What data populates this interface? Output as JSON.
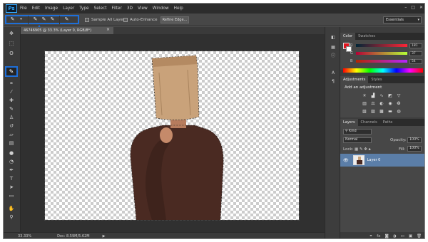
{
  "app": {
    "logo": "Ps"
  },
  "menu": [
    "File",
    "Edit",
    "Image",
    "Layer",
    "Type",
    "Select",
    "Filter",
    "3D",
    "View",
    "Window",
    "Help"
  ],
  "window_controls": [
    "–",
    "□",
    "✕"
  ],
  "options_bar": {
    "sample_all_layers": "Sample All Layers",
    "auto_enhance": "Auto-Enhance",
    "refine_edge": "Refine Edge...",
    "workspace": "Essentials"
  },
  "document": {
    "tab_title": "46746905 @ 33.3% (Layer 0, RGB/8*)",
    "tab_close": "×"
  },
  "status": {
    "zoom": "33.33%",
    "doc_info": "Doc: 8.59M/5.62M"
  },
  "color_panel": {
    "tabs": [
      "Color",
      "Swatches"
    ],
    "r_label": "R",
    "r_value": "181",
    "g_label": "G",
    "g_value": "37",
    "b_label": "B",
    "b_value": "54",
    "foreground_color": "#b52536"
  },
  "adjustments_panel": {
    "tabs": [
      "Adjustments",
      "Styles"
    ],
    "heading": "Add an adjustment"
  },
  "layers_panel": {
    "tabs": [
      "Layers",
      "Channels",
      "Paths"
    ],
    "filter_kind": "Kind",
    "blend_mode": "Normal",
    "opacity_label": "Opacity:",
    "opacity_value": "100%",
    "lock_label": "Lock:",
    "fill_label": "Fill:",
    "fill_value": "100%",
    "layer_name": "Layer 0"
  },
  "colors": {
    "highlight": "#1e6fd9",
    "layer_selected": "#5b7ea8",
    "foreground_swatch": "#e0141e"
  }
}
